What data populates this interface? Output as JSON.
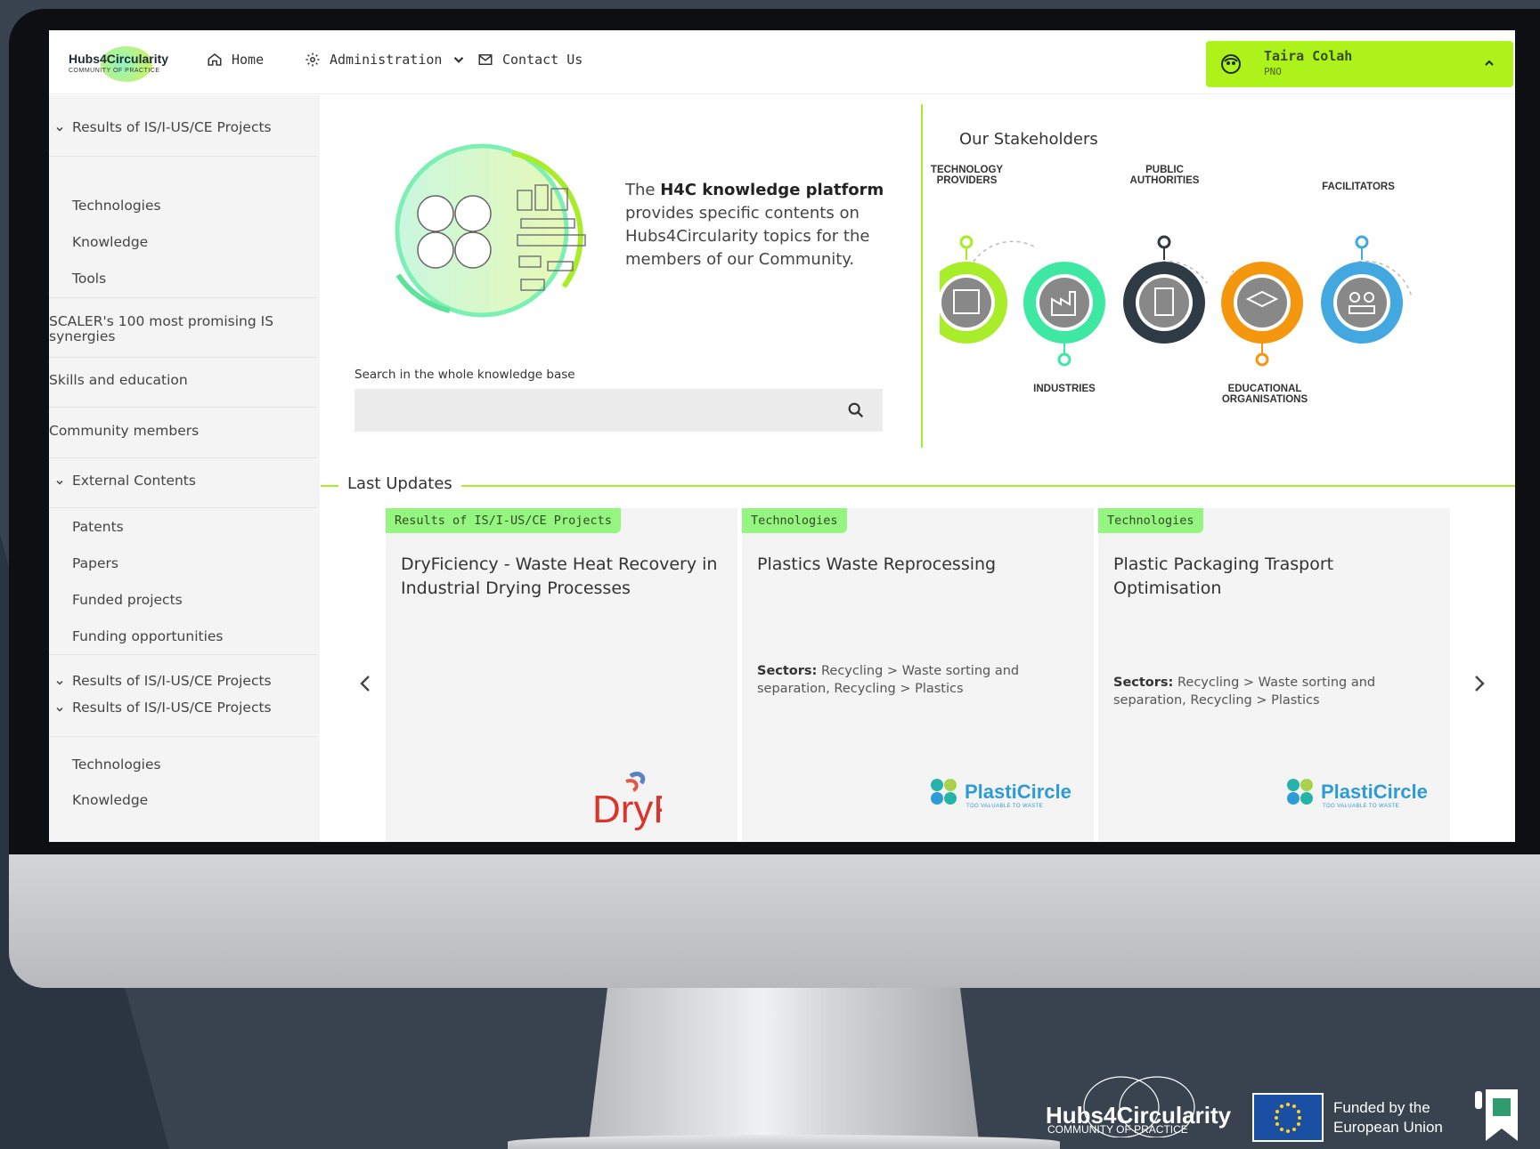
{
  "brand": {
    "name": "Hubs4Circularity",
    "tagline": "COMMUNITY OF PRACTICE"
  },
  "nav": {
    "home": "Home",
    "administration": "Administration",
    "contact": "Contact Us"
  },
  "user": {
    "name": "Taira Colah",
    "org": "PNO"
  },
  "sidebar": {
    "items": [
      {
        "label": "Results of IS/I-US/CE Projects",
        "type": "group"
      },
      {
        "label": "Technologies",
        "type": "sub"
      },
      {
        "label": "Knowledge",
        "type": "sub"
      },
      {
        "label": "Tools",
        "type": "sub"
      },
      {
        "label": "SCALER's 100 most promising IS synergies",
        "type": "top"
      },
      {
        "label": "Skills and education",
        "type": "top"
      },
      {
        "label": "Community members",
        "type": "top"
      },
      {
        "label": "External Contents",
        "type": "group"
      },
      {
        "label": "Patents",
        "type": "sub"
      },
      {
        "label": "Papers",
        "type": "sub"
      },
      {
        "label": "Funded projects",
        "type": "sub"
      },
      {
        "label": "Funding opportunities",
        "type": "sub"
      },
      {
        "label": "Results of IS/I-US/CE Projects",
        "type": "group"
      },
      {
        "label": "Results of IS/I-US/CE Projects",
        "type": "group"
      },
      {
        "label": "Technologies",
        "type": "sub"
      },
      {
        "label": "Knowledge",
        "type": "sub"
      }
    ]
  },
  "hero": {
    "text_prefix": "The ",
    "text_bold": "H4C knowledge platform",
    "text_suffix": " provides specific contents on Hubs4Circularity topics for the members of our Community."
  },
  "search": {
    "label": "Search in the whole knowledge base",
    "placeholder": ""
  },
  "stakeholders": {
    "title": "Our Stakeholders",
    "items": [
      {
        "label": "TECHNOLOGY PROVIDERS",
        "color": "#a8ec2a"
      },
      {
        "label": "INDUSTRIES",
        "color": "#3ee8a3"
      },
      {
        "label": "PUBLIC AUTHORITIES",
        "color": "#2e3a44"
      },
      {
        "label": "EDUCATIONAL ORGANISATIONS",
        "color": "#f5960f"
      },
      {
        "label": "FACILITATORS",
        "color": "#42a8df"
      }
    ]
  },
  "last_updates": {
    "title": "Last Updates",
    "cards": [
      {
        "category": "Results of IS/I-US/CE Projects",
        "title": "DryFiciency - Waste Heat Recovery in Industrial Drying Processes",
        "sectors_label": "",
        "sectors": "",
        "logo": "DryF"
      },
      {
        "category": "Technologies",
        "title": "Plastics Waste Reprocessing",
        "sectors_label": "Sectors:",
        "sectors": "Recycling > Waste sorting and separation, Recycling > Plastics",
        "logo": "PlastiCircle"
      },
      {
        "category": "Technologies",
        "title": "Plastic Packaging Trasport Optimisation",
        "sectors_label": "Sectors:",
        "sectors": "Recycling > Waste sorting and separation, Recycling > Plastics",
        "logo": "PlastiCircle"
      }
    ],
    "logo_tagline": "TOO VALUABLE TO WASTE"
  },
  "footer": {
    "brand": "Hubs4Circularity",
    "brand_sub": "COMMUNITY OF PRACTICE",
    "eu_line1": "Funded by the",
    "eu_line2": "European Union"
  },
  "colors": {
    "accent": "#a8ec2a",
    "badge": "#94f57f",
    "background": "#2a3440"
  }
}
